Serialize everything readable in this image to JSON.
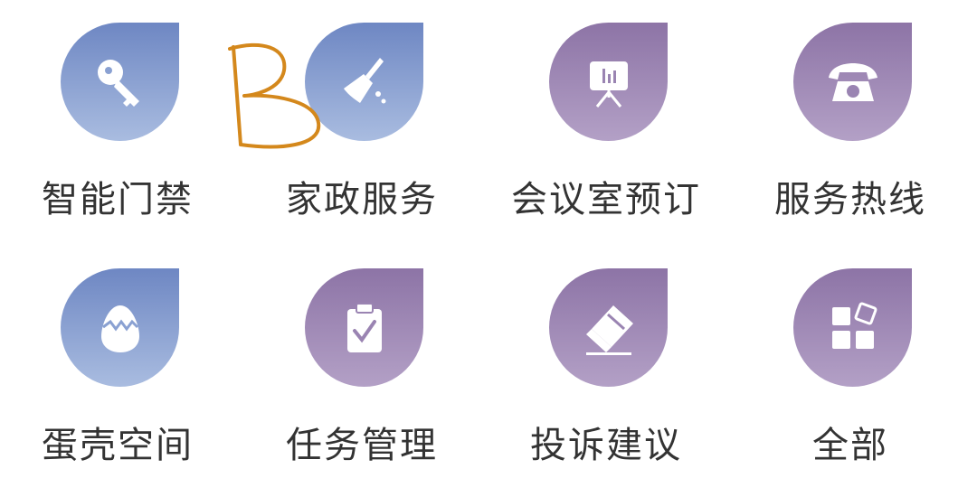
{
  "menu": {
    "items": [
      {
        "label": "智能门禁",
        "icon": "key-icon",
        "color": "#7f99cf"
      },
      {
        "label": "家政服务",
        "icon": "broom-icon",
        "color": "#7f99cf"
      },
      {
        "label": "会议室预订",
        "icon": "presentation-board-icon",
        "color": "#9a84b2"
      },
      {
        "label": "服务热线",
        "icon": "telephone-icon",
        "color": "#9a84b2"
      },
      {
        "label": "蛋壳空间",
        "icon": "cracked-egg-icon",
        "color": "#7f99cf"
      },
      {
        "label": "任务管理",
        "icon": "clipboard-check-icon",
        "color": "#9a84b2"
      },
      {
        "label": "投诉建议",
        "icon": "eraser-icon",
        "color": "#9a84b2"
      },
      {
        "label": "全部",
        "icon": "grid-apps-icon",
        "color": "#9a84b2"
      }
    ]
  },
  "annotation": {
    "text": "B",
    "color": "#d4881c"
  }
}
